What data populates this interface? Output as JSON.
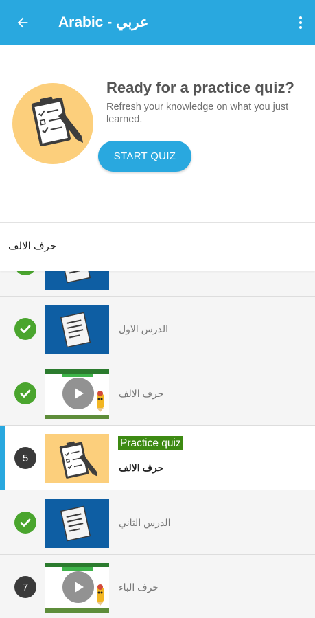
{
  "app_bar": {
    "title": "Arabic - عربي",
    "back_icon": "arrow-left-icon",
    "menu_icon": "more-vert-icon",
    "color": "#29a8df"
  },
  "quiz_prompt": {
    "heading": "Ready for a practice quiz?",
    "description": "Refresh your knowledge on what you just learned.",
    "button_label": "START QUIZ",
    "icon": "quiz-clipboard-icon"
  },
  "section": {
    "title": "حرف الالف"
  },
  "lessons": [
    {
      "status": "completed",
      "thumbnail": "document",
      "title": ""
    },
    {
      "status": "completed",
      "thumbnail": "document",
      "title": "الدرس الاول"
    },
    {
      "status": "completed",
      "thumbnail": "video",
      "title": "حرف الالف"
    },
    {
      "status": "current",
      "number": "5",
      "thumbnail": "quiz",
      "tag": "Practice quiz",
      "title": "حرف الالف"
    },
    {
      "status": "completed",
      "thumbnail": "document",
      "title": "الدرس الثاني"
    },
    {
      "status": "pending",
      "number": "7",
      "thumbnail": "video",
      "title": "حرف الباء"
    }
  ],
  "colors": {
    "accent": "#29a8df",
    "completed": "#4aa52e",
    "tag": "#3d8a12",
    "doc_thumb": "#0e5ea3",
    "quiz_thumb": "#fccf7c"
  }
}
